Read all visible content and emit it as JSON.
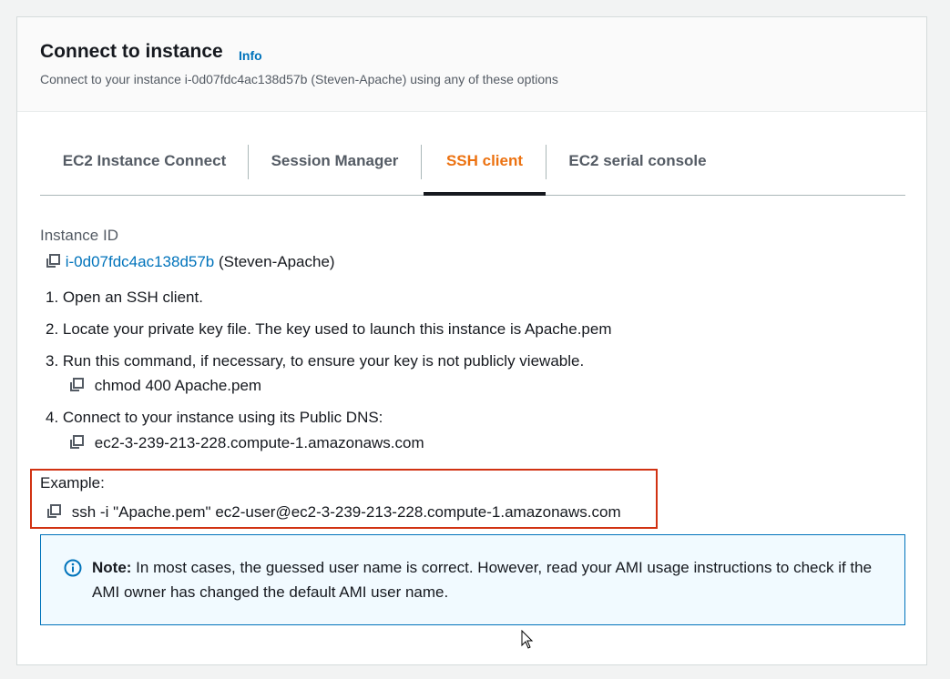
{
  "header": {
    "title": "Connect to instance",
    "info_link": "Info",
    "subtitle": "Connect to your instance i-0d07fdc4ac138d57b (Steven-Apache) using any of these options"
  },
  "tabs": [
    {
      "label": "EC2 Instance Connect",
      "active": false
    },
    {
      "label": "Session Manager",
      "active": false
    },
    {
      "label": "SSH client",
      "active": true
    },
    {
      "label": "EC2 serial console",
      "active": false
    }
  ],
  "instance": {
    "label": "Instance ID",
    "id": "i-0d07fdc4ac138d57b",
    "name": "(Steven-Apache)"
  },
  "steps": [
    {
      "text": "1. Open an SSH client."
    },
    {
      "text": "2. Locate your private key file. The key used to launch this instance is Apache.pem"
    },
    {
      "text": "3. Run this command, if necessary, to ensure your key is not publicly viewable.",
      "command": "chmod 400 Apache.pem"
    },
    {
      "text": "4. Connect to your instance using its Public DNS:",
      "command": "ec2-3-239-213-228.compute-1.amazonaws.com"
    }
  ],
  "example": {
    "label": "Example:",
    "command": "ssh -i \"Apache.pem\" ec2-user@ec2-3-239-213-228.compute-1.amazonaws.com"
  },
  "note": {
    "label": "Note:",
    "text": " In most cases, the guessed user name is correct. However, read your AMI usage instructions to check if the AMI owner has changed the default AMI user name."
  },
  "colors": {
    "accent": "#ec7211",
    "link": "#0073bb",
    "highlight_border": "#d13212",
    "note_bg": "#f1faff"
  },
  "icons": {
    "copy": "copy-icon",
    "info": "info-circle-icon",
    "cursor": "mouse-pointer-icon"
  }
}
